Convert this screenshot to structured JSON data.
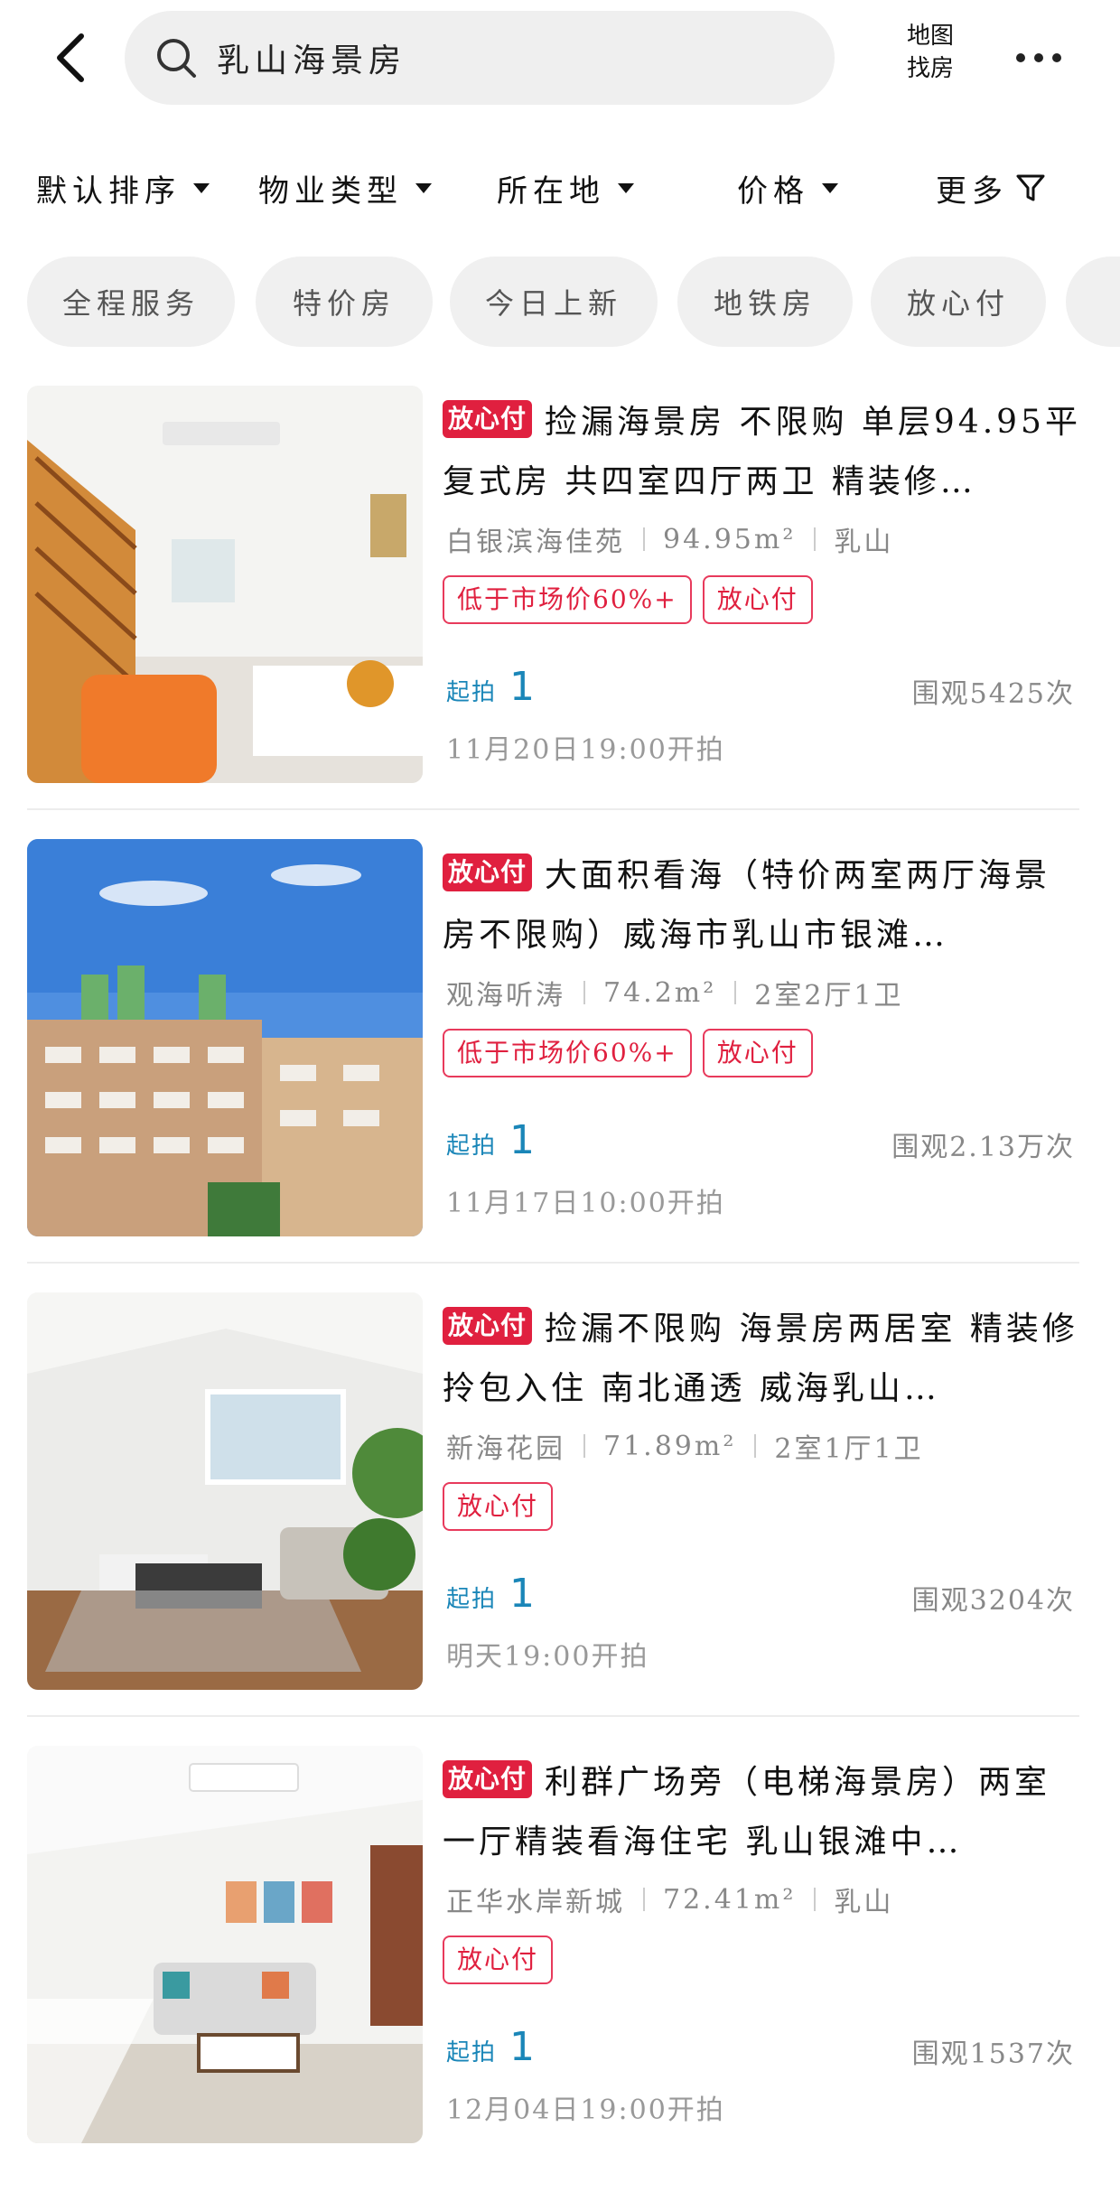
{
  "header": {
    "search_query": "乳山海景房",
    "map_label_line1": "地图",
    "map_label_line2": "找房"
  },
  "filters": [
    {
      "label": "默认排序"
    },
    {
      "label": "物业类型"
    },
    {
      "label": "所在地"
    },
    {
      "label": "价格"
    },
    {
      "label": "更多"
    }
  ],
  "chips": [
    {
      "label": "全程服务"
    },
    {
      "label": "特价房"
    },
    {
      "label": "今日上新"
    },
    {
      "label": "地铁房"
    },
    {
      "label": "放心付"
    }
  ],
  "listings": [
    {
      "badge": "放心付",
      "title": "捡漏海景房 不限购 单层94.95平复式房 共四室四厅两卫 精装修…",
      "community": "白银滨海佳苑",
      "area": "94.95m²",
      "extra": "乳山",
      "tags": [
        "低于市场价60%+",
        "放心付"
      ],
      "start_label": "起拍",
      "start_value": "1",
      "views": "围观5425次",
      "time": "11月20日19:00开拍",
      "image": "loft-interior"
    },
    {
      "badge": "放心付",
      "title": "大面积看海（特价两室两厅海景房不限购）威海市乳山市银滩…",
      "community": "观海听涛",
      "area": "74.2m²",
      "extra": "2室2厅1卫",
      "tags": [
        "低于市场价60%+",
        "放心付"
      ],
      "start_label": "起拍",
      "start_value": "1",
      "views": "围观2.13万次",
      "time": "11月17日10:00开拍",
      "image": "building-exterior"
    },
    {
      "badge": "放心付",
      "title": "捡漏不限购 海景房两居室 精装修 拎包入住 南北通透 威海乳山…",
      "community": "新海花园",
      "area": "71.89m²",
      "extra": "2室1厅1卫",
      "tags": [
        "放心付"
      ],
      "start_label": "起拍",
      "start_value": "1",
      "views": "围观3204次",
      "time": "明天19:00开拍",
      "image": "living-room"
    },
    {
      "badge": "放心付",
      "title": "利群广场旁（电梯海景房）两室一厅精装看海住宅 乳山银滩中…",
      "community": "正华水岸新城",
      "area": "72.41m²",
      "extra": "乳山",
      "tags": [
        "放心付"
      ],
      "start_label": "起拍",
      "start_value": "1",
      "views": "围观1537次",
      "time": "12月04日19:00开拍",
      "image": "bright-living-room"
    }
  ],
  "colors": {
    "accent_red": "#e0203f",
    "start_blue": "#1a86b8",
    "chip_bg": "#f0f0f0"
  }
}
